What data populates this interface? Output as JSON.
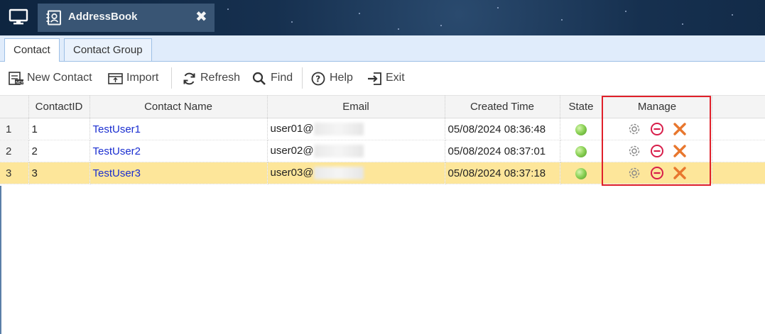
{
  "window": {
    "title": "AddressBook",
    "close_glyph": "✖"
  },
  "tabs": [
    {
      "label": "Contact",
      "active": true
    },
    {
      "label": "Contact Group",
      "active": false
    }
  ],
  "toolbar": {
    "new_contact": "New Contact",
    "import": "Import",
    "refresh": "Refresh",
    "find": "Find",
    "help": "Help",
    "exit": "Exit"
  },
  "grid": {
    "columns": [
      "ContactID",
      "Contact Name",
      "Email",
      "Created Time",
      "State",
      "Manage"
    ],
    "rows": [
      {
        "num": "1",
        "id": "1",
        "name": "TestUser1",
        "email_prefix": "user01@",
        "created": "05/08/2024 08:36:48"
      },
      {
        "num": "2",
        "id": "2",
        "name": "TestUser2",
        "email_prefix": "user02@",
        "created": "05/08/2024 08:37:01"
      },
      {
        "num": "3",
        "id": "3",
        "name": "TestUser3",
        "email_prefix": "user03@",
        "created": "05/08/2024 08:37:18",
        "selected": true
      }
    ]
  },
  "colors": {
    "selected_row": "#fde69a",
    "link": "#1a2ed0",
    "highlight_box": "#e0202a",
    "state_active": "#8fd45a",
    "remove_icon": "#d81e4a",
    "delete_icon": "#e8772e"
  },
  "icons": {
    "manage": [
      "gear-icon",
      "minus-circle-icon",
      "cross-icon"
    ],
    "toolbar": [
      "new-contact-icon",
      "import-icon",
      "refresh-icon",
      "search-icon",
      "help-icon",
      "exit-icon"
    ]
  }
}
